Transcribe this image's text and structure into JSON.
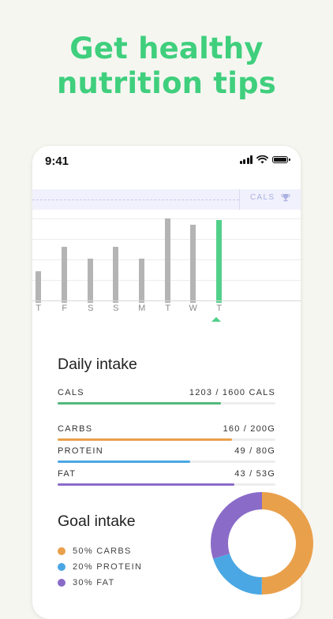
{
  "headline": {
    "line1": "Get healthy",
    "line2": "nutrition tips"
  },
  "status_bar": {
    "time": "9:41"
  },
  "week_chart": {
    "goal_label": "CALS",
    "days": [
      "T",
      "F",
      "S",
      "S",
      "M",
      "T",
      "W",
      "T"
    ],
    "values": [
      0.35,
      0.62,
      0.49,
      0.62,
      0.49,
      0.94,
      0.87,
      0.92
    ],
    "active_index": 7,
    "bar_color": "#b4b4b4",
    "active_color": "#52d08a"
  },
  "daily_intake": {
    "title": "Daily intake",
    "rows": [
      {
        "label": "CALS",
        "value": "1203 / 1600 CALS",
        "progress": 0.75,
        "color": "#52b87a"
      },
      {
        "label": "CARBS",
        "value": "160 / 200G",
        "progress": 0.8,
        "color": "#e9a04b"
      },
      {
        "label": "PROTEIN",
        "value": "49 / 80G",
        "progress": 0.61,
        "color": "#4aa7e4"
      },
      {
        "label": "FAT",
        "value": "43 / 53G",
        "progress": 0.81,
        "color": "#8a6cc8"
      }
    ]
  },
  "goal_intake": {
    "title": "Goal intake",
    "items": [
      {
        "label": "50% CARBS",
        "color": "#e9a04b",
        "share": 0.5
      },
      {
        "label": "20% PROTEIN",
        "color": "#4aa7e4",
        "share": 0.2
      },
      {
        "label": "30% FAT",
        "color": "#8a6cc8",
        "share": 0.3
      }
    ]
  }
}
